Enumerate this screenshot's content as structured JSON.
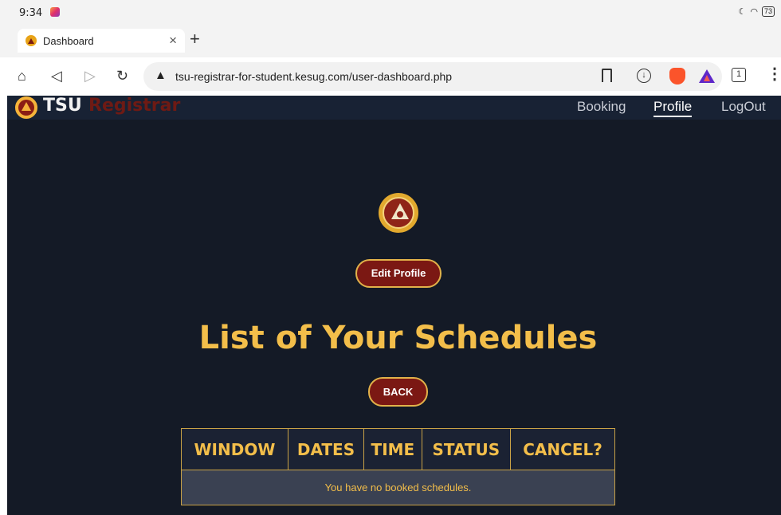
{
  "status_bar": {
    "time": "9:34",
    "battery": "73"
  },
  "browser": {
    "tab": {
      "title": "Dashboard",
      "close": "×"
    },
    "new_tab": "+",
    "url": "tsu-registrar-for-student.kesug.com/user-dashboard.php",
    "tab_count": "1",
    "icons": [
      "home-icon",
      "back-icon",
      "forward-icon",
      "reload-icon",
      "not-secure-icon",
      "bookmark-icon",
      "download-icon",
      "brave-shield-icon",
      "aurora-icon",
      "tabs-icon",
      "menu-icon"
    ]
  },
  "navbar": {
    "brand_tsu": "TSU",
    "brand_registrar": "Registrar",
    "links": [
      "Booking",
      "Profile",
      "LogOut"
    ]
  },
  "main": {
    "edit_profile": "Edit Profile",
    "heading": "List of Your Schedules",
    "back": "BACK",
    "table": {
      "headers": [
        "WINDOW",
        "DATES",
        "TIME",
        "STATUS",
        "CANCEL?"
      ],
      "empty_message": "You have no booked schedules."
    }
  },
  "colors": {
    "page_bg": "#141a26",
    "accent_gold": "#f3be4a",
    "button_maroon": "#7b1813"
  }
}
